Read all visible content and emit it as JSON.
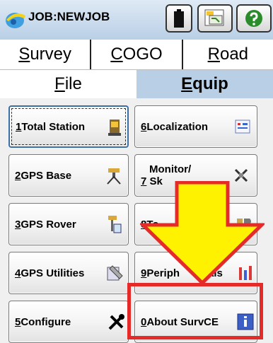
{
  "titlebar": {
    "job_title": "JOB:NEWJOB",
    "icons": [
      "survce-logo-icon",
      "battery-icon",
      "project-notes-icon",
      "help-icon"
    ]
  },
  "tabs": {
    "row1": [
      "Survey",
      "COGO",
      "Road"
    ],
    "row2": [
      "File",
      "Equip"
    ],
    "active": "Equip"
  },
  "buttons": [
    {
      "key": "1",
      "label": " Total Station",
      "icon": "total-station-icon"
    },
    {
      "key": "2",
      "label": " GPS Base",
      "icon": "gps-base-icon"
    },
    {
      "key": "3",
      "label": " GPS Rover",
      "icon": "gps-rover-icon"
    },
    {
      "key": "4",
      "label": " GPS Utilities",
      "icon": "gps-utilities-icon"
    },
    {
      "key": "5",
      "label": " Configure",
      "icon": "configure-tools-icon"
    },
    {
      "key": "6",
      "label": " Localization",
      "icon": "localization-icon"
    },
    {
      "key": "7",
      "label1": "Monitor/",
      "label2": " Sk",
      "icon": "monitor-skyplot-icon"
    },
    {
      "key": "8",
      "label": " To",
      "icon": "tolerances-icon"
    },
    {
      "key": "9",
      "label": " Periph",
      "label_tail": "als",
      "icon": "peripherals-icon"
    },
    {
      "key": "0",
      "label": " About SurvCE",
      "icon": "info-icon"
    }
  ],
  "colors": {
    "accent_tab": "#b9cfe6",
    "annotation_red": "#e52a2a",
    "annotation_yellow": "#fff200"
  }
}
